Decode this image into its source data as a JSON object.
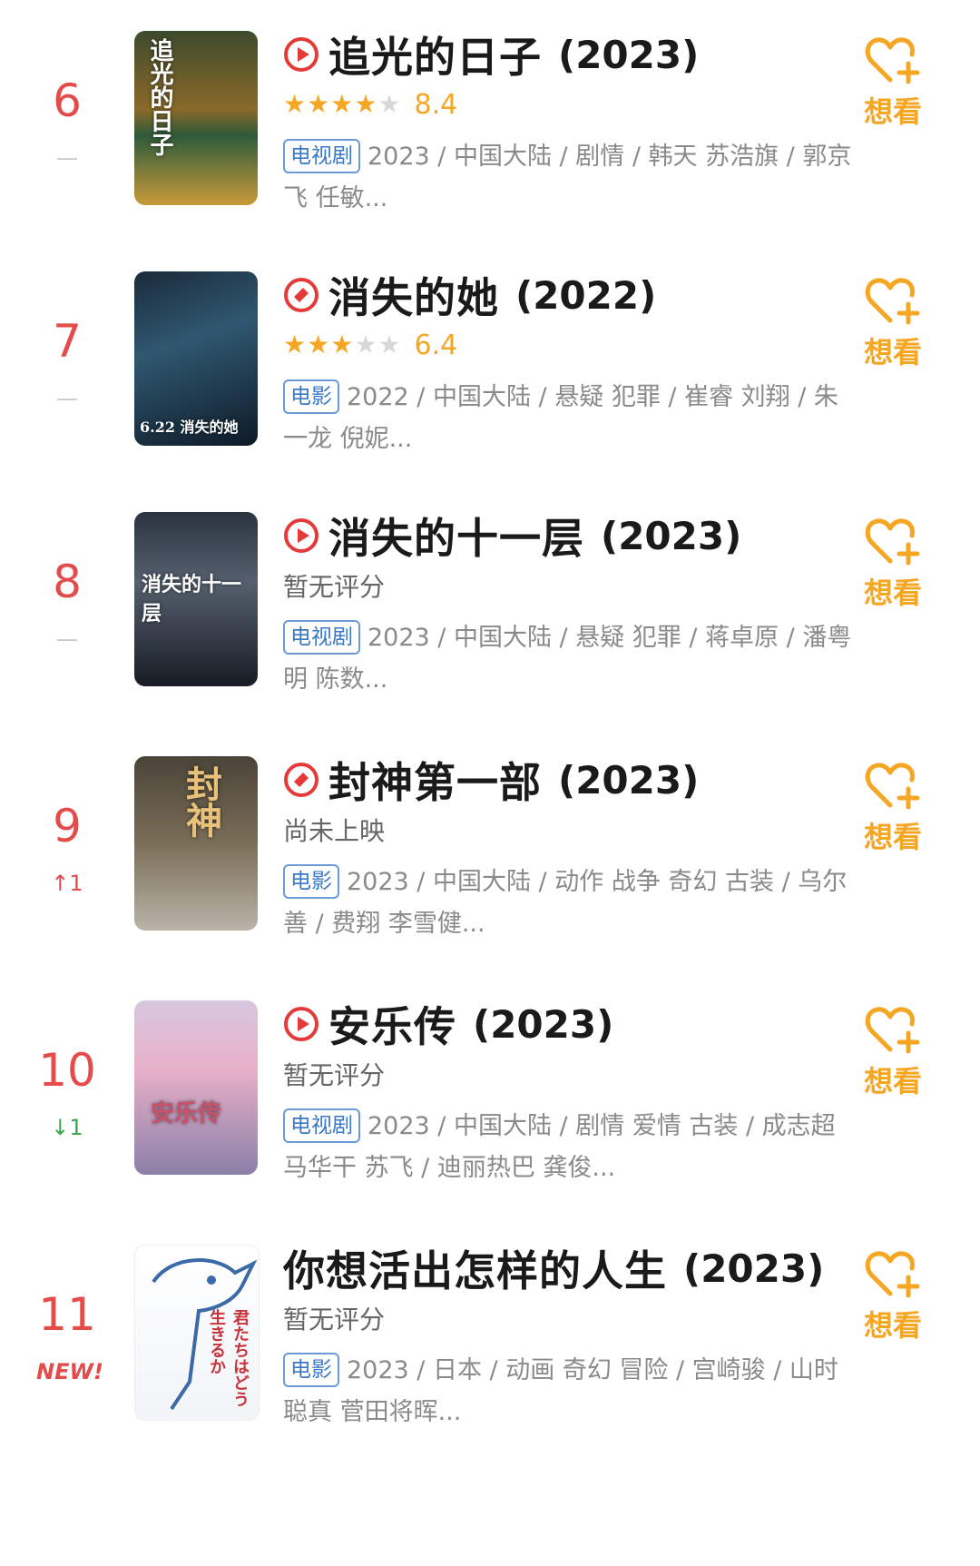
{
  "accent_color": "#f5a623",
  "rank_color": "#e44b4b",
  "items": [
    {
      "rank": "6",
      "change": "—",
      "change_type": "same",
      "has_play": true,
      "title": "追光的日子",
      "year": "(2023)",
      "stars": 4,
      "score": "8.4",
      "rating_text": "",
      "type_tag": "电视剧",
      "meta": "2023 / 中国大陆 / 剧情 / 韩天 苏浩旗 / 郭京飞 任敏...",
      "want": "想看",
      "poster_text": "追光的日子"
    },
    {
      "rank": "7",
      "change": "—",
      "change_type": "same",
      "has_play": true,
      "title": "消失的她",
      "year": "(2022)",
      "stars": 3,
      "score": "6.4",
      "rating_text": "",
      "type_tag": "电影",
      "meta": "2022 / 中国大陆 / 悬疑 犯罪 / 崔睿 刘翔 / 朱一龙 倪妮...",
      "want": "想看",
      "poster_text": "6.22 消失的她"
    },
    {
      "rank": "8",
      "change": "—",
      "change_type": "same",
      "has_play": true,
      "title": "消失的十一层",
      "year": "(2023)",
      "stars": 0,
      "score": "",
      "rating_text": "暂无评分",
      "type_tag": "电视剧",
      "meta": "2023 / 中国大陆 / 悬疑 犯罪 / 蒋卓原 / 潘粤明 陈数...",
      "want": "想看",
      "poster_text": "消失的十一层"
    },
    {
      "rank": "9",
      "change": "↑1",
      "change_type": "up",
      "has_play": true,
      "title": "封神第一部",
      "year": "(2023)",
      "stars": 0,
      "score": "",
      "rating_text": "尚未上映",
      "type_tag": "电影",
      "meta": "2023 / 中国大陆 / 动作 战争 奇幻 古装 / 乌尔善 / 费翔 李雪健...",
      "want": "想看",
      "poster_text": "封神"
    },
    {
      "rank": "10",
      "change": "↓1",
      "change_type": "down",
      "has_play": true,
      "title": "安乐传",
      "year": "(2023)",
      "stars": 0,
      "score": "",
      "rating_text": "暂无评分",
      "type_tag": "电视剧",
      "meta": "2023 / 中国大陆 / 剧情 爱情 古装 / 成志超 马华干 苏飞 / 迪丽热巴 龚俊...",
      "want": "想看",
      "poster_text": "安乐传"
    },
    {
      "rank": "11",
      "change": "NEW!",
      "change_type": "new",
      "has_play": false,
      "title": "你想活出怎样的人生",
      "year": "(2023)",
      "stars": 0,
      "score": "",
      "rating_text": "暂无评分",
      "type_tag": "电影",
      "meta": "2023 / 日本 / 动画 奇幻 冒险 / 宫崎骏 / 山时聪真 菅田将晖...",
      "want": "想看",
      "poster_text": "君たちはどう生きるか"
    }
  ]
}
